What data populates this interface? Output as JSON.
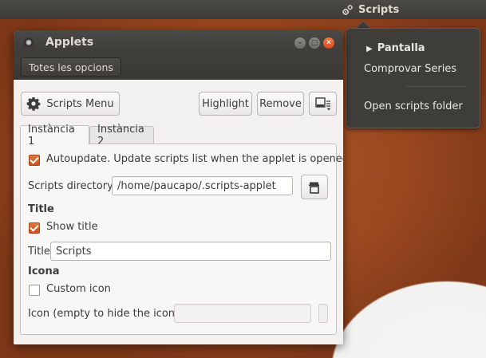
{
  "topbar": {
    "indicator_label": "Scripts",
    "indicator_icon": "gears-icon"
  },
  "menu": {
    "items": [
      {
        "label": "Pantalla",
        "marker": "▶"
      },
      {
        "label": "Comprovar Series"
      },
      {
        "label": "Open scripts folder"
      }
    ]
  },
  "window": {
    "title": "Applets",
    "toolbar": {
      "all_options_label": "Totes les opcions"
    },
    "buttons": {
      "scripts_menu": "Scripts Menu",
      "highlight": "Highlight",
      "remove": "Remove"
    },
    "tabs": [
      "Instància 1",
      "Instància 2"
    ],
    "settings": {
      "autoupdate_label": "Autoupdate. Update scripts list when the applet is opened.",
      "autoupdate_checked": true,
      "scripts_directory_label": "Scripts directory",
      "scripts_directory_value": "/home/paucapo/.scripts-applet",
      "title_section": "Title",
      "show_title_label": "Show title",
      "show_title_checked": true,
      "title_field_label": "Title",
      "title_field_value": "Scripts",
      "icon_section": "Icona",
      "custom_icon_label": "Custom icon",
      "custom_icon_checked": false,
      "icon_field_label": "Icon (empty to hide the icon)",
      "icon_field_value": ""
    }
  },
  "colors": {
    "accent_orange": "#dd5a25",
    "topbar_bg": "#3c3b37",
    "window_bg": "#f2f1f0"
  }
}
